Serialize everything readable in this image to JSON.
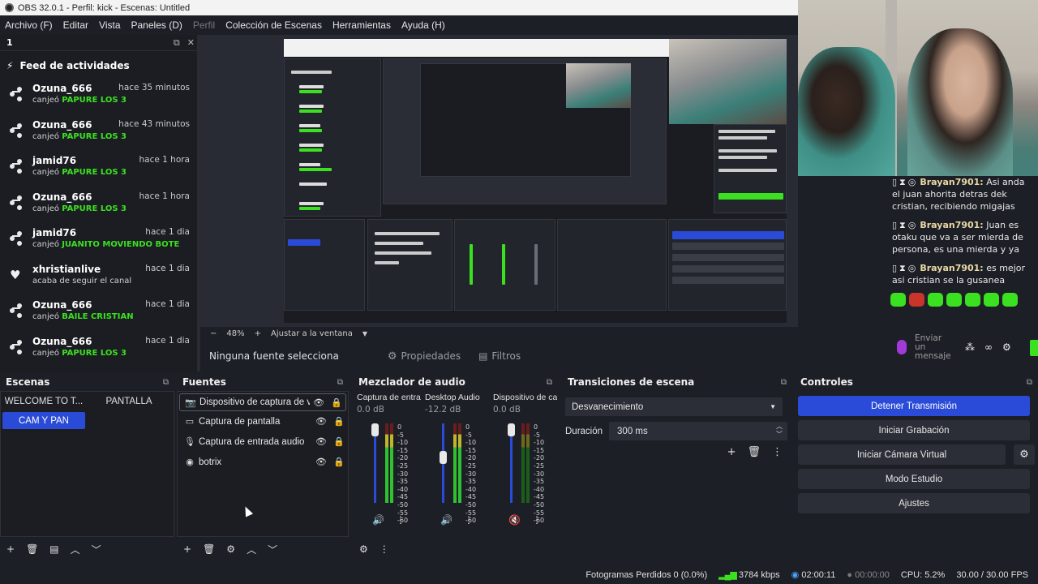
{
  "titlebar": {
    "text": "OBS 32.0.1 - Perfil: kick - Escenas: Untitled"
  },
  "menu": [
    "Archivo (F)",
    "Editar",
    "Vista",
    "Paneles (D)",
    "Perfil",
    "Colección de Escenas",
    "Herramientas",
    "Ayuda (H)"
  ],
  "feed": {
    "dock_title": "1",
    "header": "Feed de actividades",
    "items": [
      {
        "user": "Ozuna_666",
        "time": "hace 35 minutos",
        "action": "canjeó",
        "reward": "PAPURE LOS 3",
        "icon": "points-icon"
      },
      {
        "user": "Ozuna_666",
        "time": "hace 43 minutos",
        "action": "canjeó",
        "reward": "PAPURE LOS 3",
        "icon": "points-icon"
      },
      {
        "user": "jamid76",
        "time": "hace 1 hora",
        "action": "canjeó",
        "reward": "PAPURE LOS 3",
        "icon": "points-icon"
      },
      {
        "user": "Ozuna_666",
        "time": "hace 1 hora",
        "action": "canjeó",
        "reward": "PAPURE LOS 3",
        "icon": "points-icon"
      },
      {
        "user": "jamid76",
        "time": "hace 1 dia",
        "action": "canjeó",
        "reward": "JUANITO MOVIENDO BOTE",
        "icon": "points-icon"
      },
      {
        "user": "xhristianlive",
        "time": "hace 1 dia",
        "action": "acaba de seguir el canal",
        "reward": "",
        "icon": "heart-icon"
      },
      {
        "user": "Ozuna_666",
        "time": "hace 1 dia",
        "action": "canjeó",
        "reward": "BAILE CRISTIAN",
        "icon": "points-icon"
      },
      {
        "user": "Ozuna_666",
        "time": "hace 1 dia",
        "action": "canjeó",
        "reward": "PAPURE LOS 3",
        "icon": "points-icon"
      }
    ]
  },
  "preview": {
    "zoom": "48%",
    "fit_label": "Ajustar a la ventana"
  },
  "source_bar": {
    "none_selected": "Ninguna fuente selecciona",
    "properties": "Propiedades",
    "filters": "Filtros"
  },
  "chat": {
    "messages": [
      {
        "user": "Brayan7901:",
        "text": "Asi anda el juan ahorita detras dek cristian, recibiendo migajas"
      },
      {
        "user": "Brayan7901:",
        "text": "Juan es otaku que va a ser mierda de persona, es una mierda y ya"
      },
      {
        "user": "Brayan7901:",
        "text": "es mejor asi cristian se la gusanea"
      }
    ],
    "input_placeholder": "Enviar un mensaje"
  },
  "scenes": {
    "title": "Escenas",
    "items": [
      {
        "label": "WELCOME TO T...",
        "selected": false
      },
      {
        "label": "PANTALLA",
        "selected": false
      },
      {
        "label": "CAM Y PAN",
        "selected": true
      }
    ]
  },
  "sources": {
    "title": "Fuentes",
    "items": [
      {
        "label": "Dispositivo de captura de v",
        "icon": "camera-icon",
        "selected": true
      },
      {
        "label": "Captura de pantalla",
        "icon": "monitor-icon",
        "selected": false
      },
      {
        "label": "Captura de entrada audio",
        "icon": "microphone-icon",
        "selected": false
      },
      {
        "label": "botrix",
        "icon": "globe-icon",
        "selected": false
      }
    ]
  },
  "mixer": {
    "title": "Mezclador de audio",
    "channels": [
      {
        "name": "Captura de entrada",
        "db": "0.0 dB",
        "active": true,
        "muted": false
      },
      {
        "name": "Desktop Audio",
        "db": "-12.2 dB",
        "active": true,
        "muted": false
      },
      {
        "name": "Dispositivo de capt",
        "db": "0.0 dB",
        "active": false,
        "muted": true
      }
    ],
    "scale": [
      "0",
      "-5",
      "-10",
      "-15",
      "-20",
      "-25",
      "-30",
      "-35",
      "-40",
      "-45",
      "-50",
      "-55",
      "-60"
    ]
  },
  "transitions": {
    "title": "Transiciones de escena",
    "selected": "Desvanecimiento",
    "duration_label": "Duración",
    "duration_value": "300 ms"
  },
  "controls": {
    "title": "Controles",
    "buttons": [
      "Detener Transmisión",
      "Iniciar Grabación",
      "Iniciar Cámara Virtual",
      "Modo Estudio",
      "Ajustes"
    ]
  },
  "status": {
    "dropped": "Fotogramas Perdidos 0 (0.0%)",
    "bitrate": "3784 kbps",
    "live_time": "02:00:11",
    "rec_time": "00:00:00",
    "cpu": "CPU: 5.2%",
    "fps": "30.00 / 30.00 FPS"
  },
  "colors": {
    "accent": "#2a4bd7",
    "reward_green": "#3be020",
    "background": "#1d1f26"
  }
}
